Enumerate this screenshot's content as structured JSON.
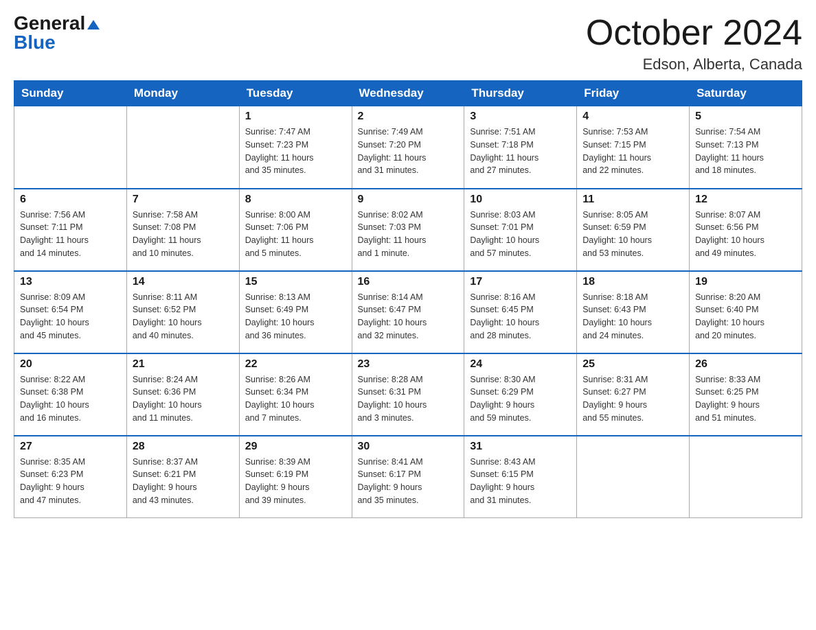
{
  "logo": {
    "general": "General",
    "blue": "Blue"
  },
  "title": "October 2024",
  "location": "Edson, Alberta, Canada",
  "days_of_week": [
    "Sunday",
    "Monday",
    "Tuesday",
    "Wednesday",
    "Thursday",
    "Friday",
    "Saturday"
  ],
  "weeks": [
    [
      {
        "day": "",
        "info": ""
      },
      {
        "day": "",
        "info": ""
      },
      {
        "day": "1",
        "info": "Sunrise: 7:47 AM\nSunset: 7:23 PM\nDaylight: 11 hours\nand 35 minutes."
      },
      {
        "day": "2",
        "info": "Sunrise: 7:49 AM\nSunset: 7:20 PM\nDaylight: 11 hours\nand 31 minutes."
      },
      {
        "day": "3",
        "info": "Sunrise: 7:51 AM\nSunset: 7:18 PM\nDaylight: 11 hours\nand 27 minutes."
      },
      {
        "day": "4",
        "info": "Sunrise: 7:53 AM\nSunset: 7:15 PM\nDaylight: 11 hours\nand 22 minutes."
      },
      {
        "day": "5",
        "info": "Sunrise: 7:54 AM\nSunset: 7:13 PM\nDaylight: 11 hours\nand 18 minutes."
      }
    ],
    [
      {
        "day": "6",
        "info": "Sunrise: 7:56 AM\nSunset: 7:11 PM\nDaylight: 11 hours\nand 14 minutes."
      },
      {
        "day": "7",
        "info": "Sunrise: 7:58 AM\nSunset: 7:08 PM\nDaylight: 11 hours\nand 10 minutes."
      },
      {
        "day": "8",
        "info": "Sunrise: 8:00 AM\nSunset: 7:06 PM\nDaylight: 11 hours\nand 5 minutes."
      },
      {
        "day": "9",
        "info": "Sunrise: 8:02 AM\nSunset: 7:03 PM\nDaylight: 11 hours\nand 1 minute."
      },
      {
        "day": "10",
        "info": "Sunrise: 8:03 AM\nSunset: 7:01 PM\nDaylight: 10 hours\nand 57 minutes."
      },
      {
        "day": "11",
        "info": "Sunrise: 8:05 AM\nSunset: 6:59 PM\nDaylight: 10 hours\nand 53 minutes."
      },
      {
        "day": "12",
        "info": "Sunrise: 8:07 AM\nSunset: 6:56 PM\nDaylight: 10 hours\nand 49 minutes."
      }
    ],
    [
      {
        "day": "13",
        "info": "Sunrise: 8:09 AM\nSunset: 6:54 PM\nDaylight: 10 hours\nand 45 minutes."
      },
      {
        "day": "14",
        "info": "Sunrise: 8:11 AM\nSunset: 6:52 PM\nDaylight: 10 hours\nand 40 minutes."
      },
      {
        "day": "15",
        "info": "Sunrise: 8:13 AM\nSunset: 6:49 PM\nDaylight: 10 hours\nand 36 minutes."
      },
      {
        "day": "16",
        "info": "Sunrise: 8:14 AM\nSunset: 6:47 PM\nDaylight: 10 hours\nand 32 minutes."
      },
      {
        "day": "17",
        "info": "Sunrise: 8:16 AM\nSunset: 6:45 PM\nDaylight: 10 hours\nand 28 minutes."
      },
      {
        "day": "18",
        "info": "Sunrise: 8:18 AM\nSunset: 6:43 PM\nDaylight: 10 hours\nand 24 minutes."
      },
      {
        "day": "19",
        "info": "Sunrise: 8:20 AM\nSunset: 6:40 PM\nDaylight: 10 hours\nand 20 minutes."
      }
    ],
    [
      {
        "day": "20",
        "info": "Sunrise: 8:22 AM\nSunset: 6:38 PM\nDaylight: 10 hours\nand 16 minutes."
      },
      {
        "day": "21",
        "info": "Sunrise: 8:24 AM\nSunset: 6:36 PM\nDaylight: 10 hours\nand 11 minutes."
      },
      {
        "day": "22",
        "info": "Sunrise: 8:26 AM\nSunset: 6:34 PM\nDaylight: 10 hours\nand 7 minutes."
      },
      {
        "day": "23",
        "info": "Sunrise: 8:28 AM\nSunset: 6:31 PM\nDaylight: 10 hours\nand 3 minutes."
      },
      {
        "day": "24",
        "info": "Sunrise: 8:30 AM\nSunset: 6:29 PM\nDaylight: 9 hours\nand 59 minutes."
      },
      {
        "day": "25",
        "info": "Sunrise: 8:31 AM\nSunset: 6:27 PM\nDaylight: 9 hours\nand 55 minutes."
      },
      {
        "day": "26",
        "info": "Sunrise: 8:33 AM\nSunset: 6:25 PM\nDaylight: 9 hours\nand 51 minutes."
      }
    ],
    [
      {
        "day": "27",
        "info": "Sunrise: 8:35 AM\nSunset: 6:23 PM\nDaylight: 9 hours\nand 47 minutes."
      },
      {
        "day": "28",
        "info": "Sunrise: 8:37 AM\nSunset: 6:21 PM\nDaylight: 9 hours\nand 43 minutes."
      },
      {
        "day": "29",
        "info": "Sunrise: 8:39 AM\nSunset: 6:19 PM\nDaylight: 9 hours\nand 39 minutes."
      },
      {
        "day": "30",
        "info": "Sunrise: 8:41 AM\nSunset: 6:17 PM\nDaylight: 9 hours\nand 35 minutes."
      },
      {
        "day": "31",
        "info": "Sunrise: 8:43 AM\nSunset: 6:15 PM\nDaylight: 9 hours\nand 31 minutes."
      },
      {
        "day": "",
        "info": ""
      },
      {
        "day": "",
        "info": ""
      }
    ]
  ]
}
